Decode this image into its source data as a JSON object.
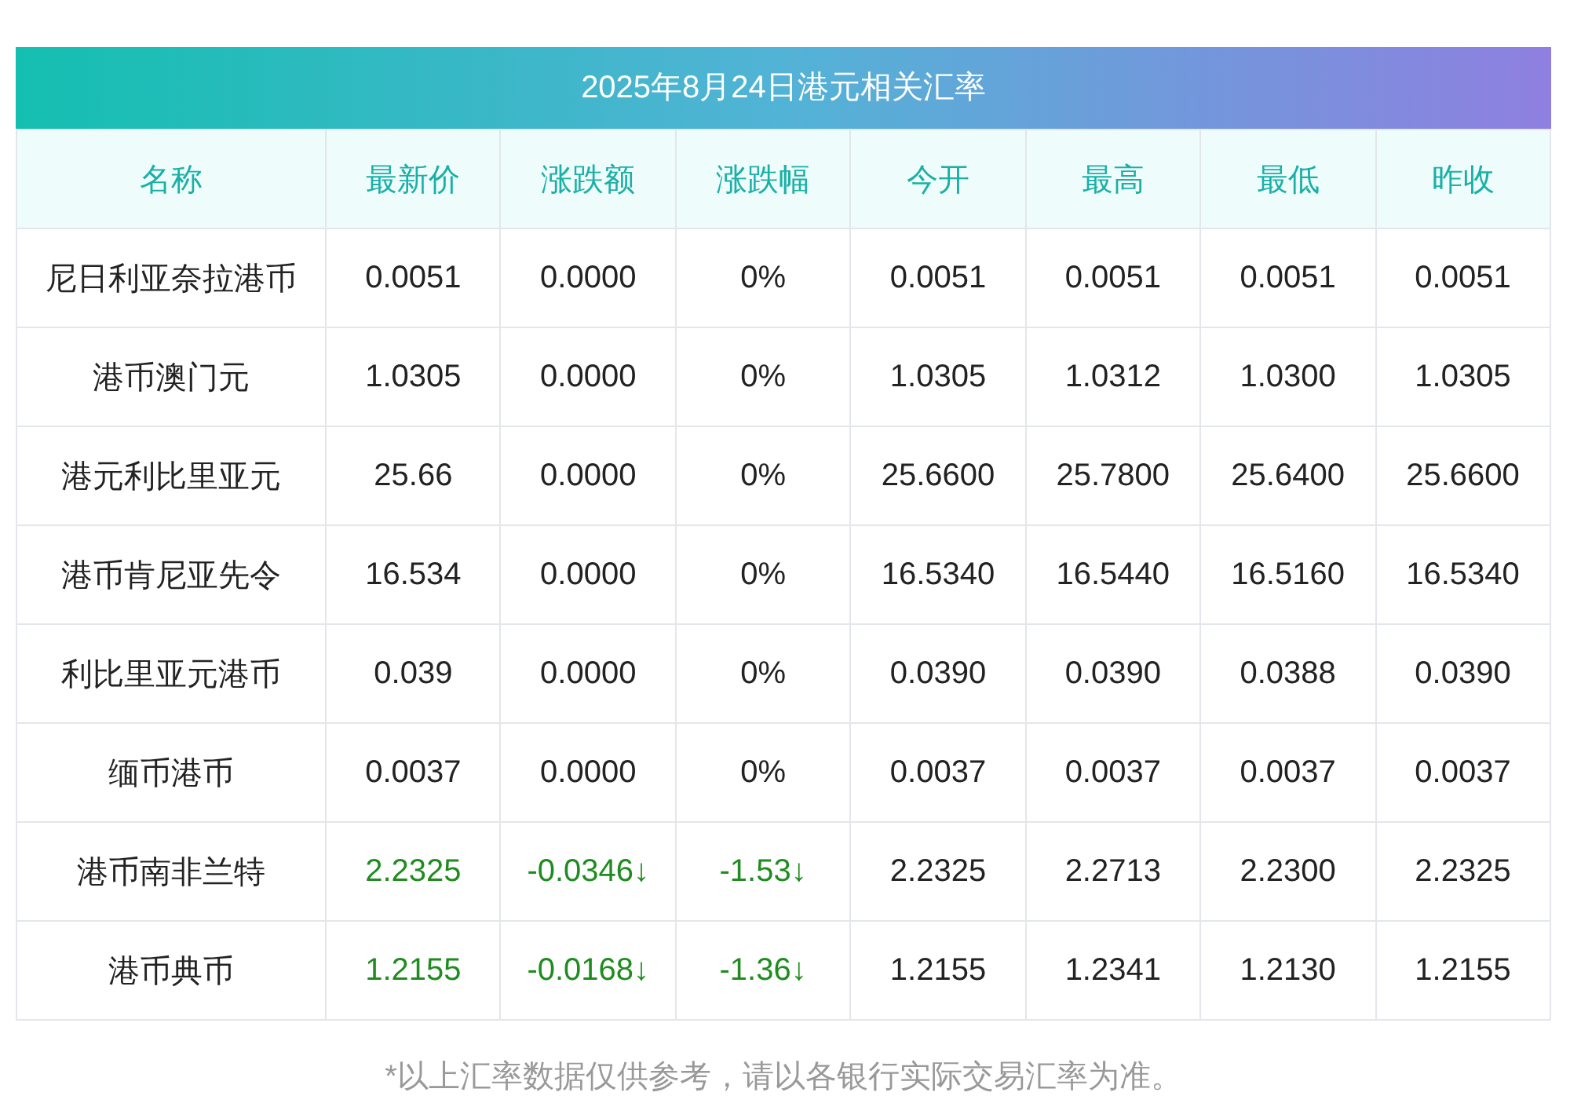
{
  "title": "2025年8月24日港元相关汇率",
  "columns": [
    "名称",
    "最新价",
    "涨跌额",
    "涨跌幅",
    "今开",
    "最高",
    "最低",
    "昨收"
  ],
  "rows": [
    {
      "kind": "flat",
      "cells": [
        "尼日利亚奈拉港币",
        "0.0051",
        "0.0000",
        "0%",
        "0.0051",
        "0.0051",
        "0.0051",
        "0.0051"
      ]
    },
    {
      "kind": "flat",
      "cells": [
        "港币澳门元",
        "1.0305",
        "0.0000",
        "0%",
        "1.0305",
        "1.0312",
        "1.0300",
        "1.0305"
      ]
    },
    {
      "kind": "flat",
      "cells": [
        "港元利比里亚元",
        "25.66",
        "0.0000",
        "0%",
        "25.6600",
        "25.7800",
        "25.6400",
        "25.6600"
      ]
    },
    {
      "kind": "flat",
      "cells": [
        "港币肯尼亚先令",
        "16.534",
        "0.0000",
        "0%",
        "16.5340",
        "16.5440",
        "16.5160",
        "16.5340"
      ]
    },
    {
      "kind": "flat",
      "cells": [
        "利比里亚元港币",
        "0.039",
        "0.0000",
        "0%",
        "0.0390",
        "0.0390",
        "0.0388",
        "0.0390"
      ]
    },
    {
      "kind": "flat",
      "cells": [
        "缅币港币",
        "0.0037",
        "0.0000",
        "0%",
        "0.0037",
        "0.0037",
        "0.0037",
        "0.0037"
      ]
    },
    {
      "kind": "down",
      "cells": [
        "港币南非兰特",
        "2.2325",
        "-0.0346↓",
        "-1.53↓",
        "2.2325",
        "2.2713",
        "2.2300",
        "2.2325"
      ]
    },
    {
      "kind": "down",
      "cells": [
        "港币典币",
        "1.2155",
        "-0.0168↓",
        "-1.36↓",
        "1.2155",
        "1.2341",
        "1.2130",
        "1.2155"
      ]
    }
  ],
  "note": "*以上汇率数据仅供参考，请以各银行实际交易汇率为准。"
}
